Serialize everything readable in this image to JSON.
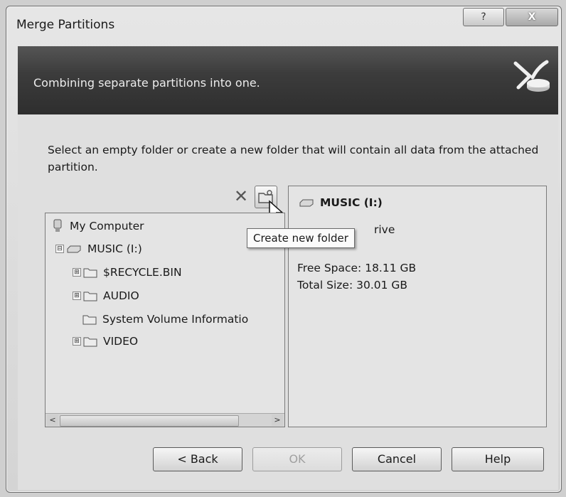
{
  "window": {
    "title": "Merge Partitions",
    "help_label": "?",
    "close_label": "X"
  },
  "banner": {
    "text": "Combining separate partitions into one.",
    "icon": "merge-icon"
  },
  "instructions": "Select an empty folder or create a new folder that will contain all data from the attached partition.",
  "toolbar": {
    "delete_label": "✕",
    "new_folder_icon": "new-folder-icon"
  },
  "tooltip": "Create new folder",
  "tree": {
    "root": "My Computer",
    "drive": "MUSIC (I:)",
    "folders": [
      {
        "label": "$RECYCLE.BIN",
        "expander": "⊞"
      },
      {
        "label": "AUDIO",
        "expander": "⊞"
      },
      {
        "label": "System Volume Informatio",
        "expander": ""
      },
      {
        "label": "VIDEO",
        "expander": "⊞"
      }
    ],
    "drive_expander": "⊟"
  },
  "scroll": {
    "left": "<",
    "right": ">"
  },
  "info": {
    "drive": "MUSIC (I:)",
    "type_partial": "rive",
    "free_space": "Free Space: 18.11 GB",
    "total_size": "Total Size: 30.01 GB"
  },
  "buttons": {
    "back": "< Back",
    "ok": "OK",
    "cancel": "Cancel",
    "help": "Help"
  }
}
